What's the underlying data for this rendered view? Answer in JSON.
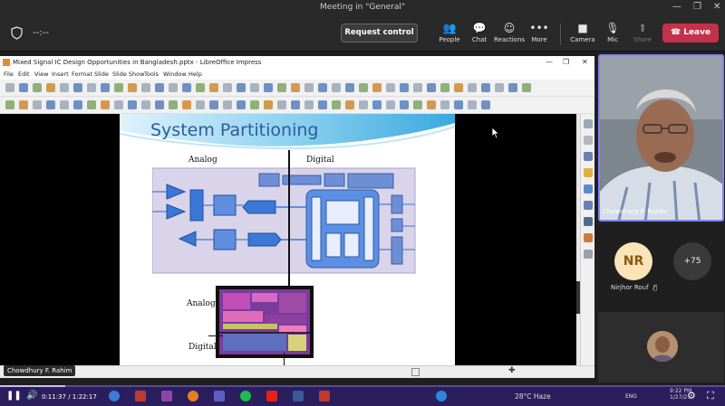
{
  "window": {
    "title": "Meeting in \"General\""
  },
  "meeting": {
    "timer": "--:--",
    "request_control": "Request control",
    "tools": [
      {
        "name": "people",
        "label": "People",
        "icon": "people-icon"
      },
      {
        "name": "chat",
        "label": "Chat",
        "icon": "chat-icon"
      },
      {
        "name": "reactions",
        "label": "Reactions",
        "icon": "reactions-icon"
      },
      {
        "name": "more",
        "label": "More",
        "icon": "more-icon"
      },
      {
        "name": "camera",
        "label": "Camera",
        "icon": "camera-icon"
      },
      {
        "name": "mic",
        "label": "Mic",
        "icon": "mic-off-icon"
      },
      {
        "name": "share",
        "label": "Share",
        "icon": "share-icon"
      }
    ],
    "leave": "Leave",
    "accent_leave": "#c4314b"
  },
  "impress": {
    "title": "Mixed Signal IC Design Opportunities in Bangladesh.pptx - LibreOffice Impress",
    "menu": [
      "File",
      "Edit",
      "View",
      "Insert",
      "Format",
      "Slide",
      "Slide Show",
      "Tools",
      "Window",
      "Help"
    ]
  },
  "slide": {
    "title": "System Partitioning",
    "label_analog_top": "Analog",
    "label_digital_top": "Digital",
    "label_analog_die": "Analog",
    "label_digital_die": "Digital"
  },
  "presenter_name": "Chowdhury F. Rahim",
  "participants": {
    "video_name": "Chowdhury F. Rahim",
    "nr_initials": "NR",
    "nr_name": "Nirjhor Rouf",
    "more_count": "+75"
  },
  "player": {
    "time": "0:11:37 / 1:22:17",
    "progress": 0.09
  },
  "taskbar": {
    "weather": "28°C  Haze",
    "lang": "ENG",
    "clock_time": "9:22 PM",
    "clock_date": "1/27/2..."
  }
}
